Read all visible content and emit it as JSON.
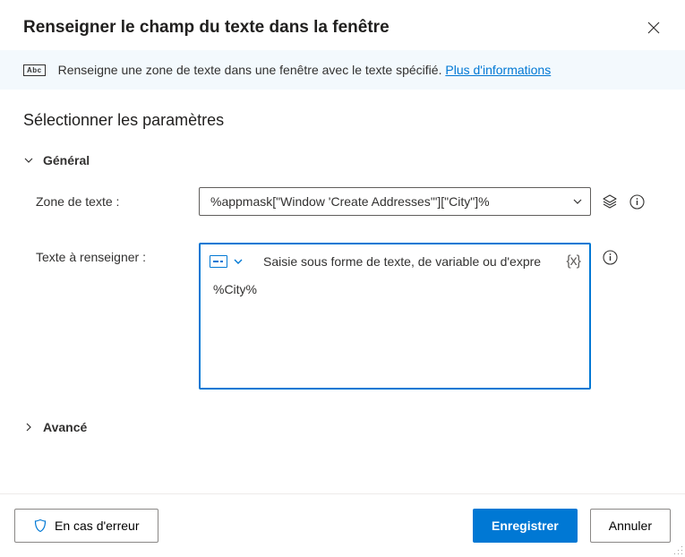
{
  "dialog": {
    "title": "Renseigner le champ du texte dans la fenêtre"
  },
  "info": {
    "text": "Renseigne une zone de texte dans une fenêtre avec le texte spécifié. ",
    "link": "Plus d'informations"
  },
  "section": {
    "title": "Sélectionner les paramètres"
  },
  "general": {
    "label": "Général",
    "textbox_label": "Zone de texte :",
    "textbox_value": "%appmask[\"Window 'Create Addresses'\"][\"City\"]%",
    "text_to_fill_label": "Texte à renseigner :",
    "text_placeholder": "Saisie sous forme de texte, de variable ou d'expre",
    "text_value": "%City%"
  },
  "advanced": {
    "label": "Avancé"
  },
  "footer": {
    "on_error": "En cas d'erreur",
    "save": "Enregistrer",
    "cancel": "Annuler"
  }
}
